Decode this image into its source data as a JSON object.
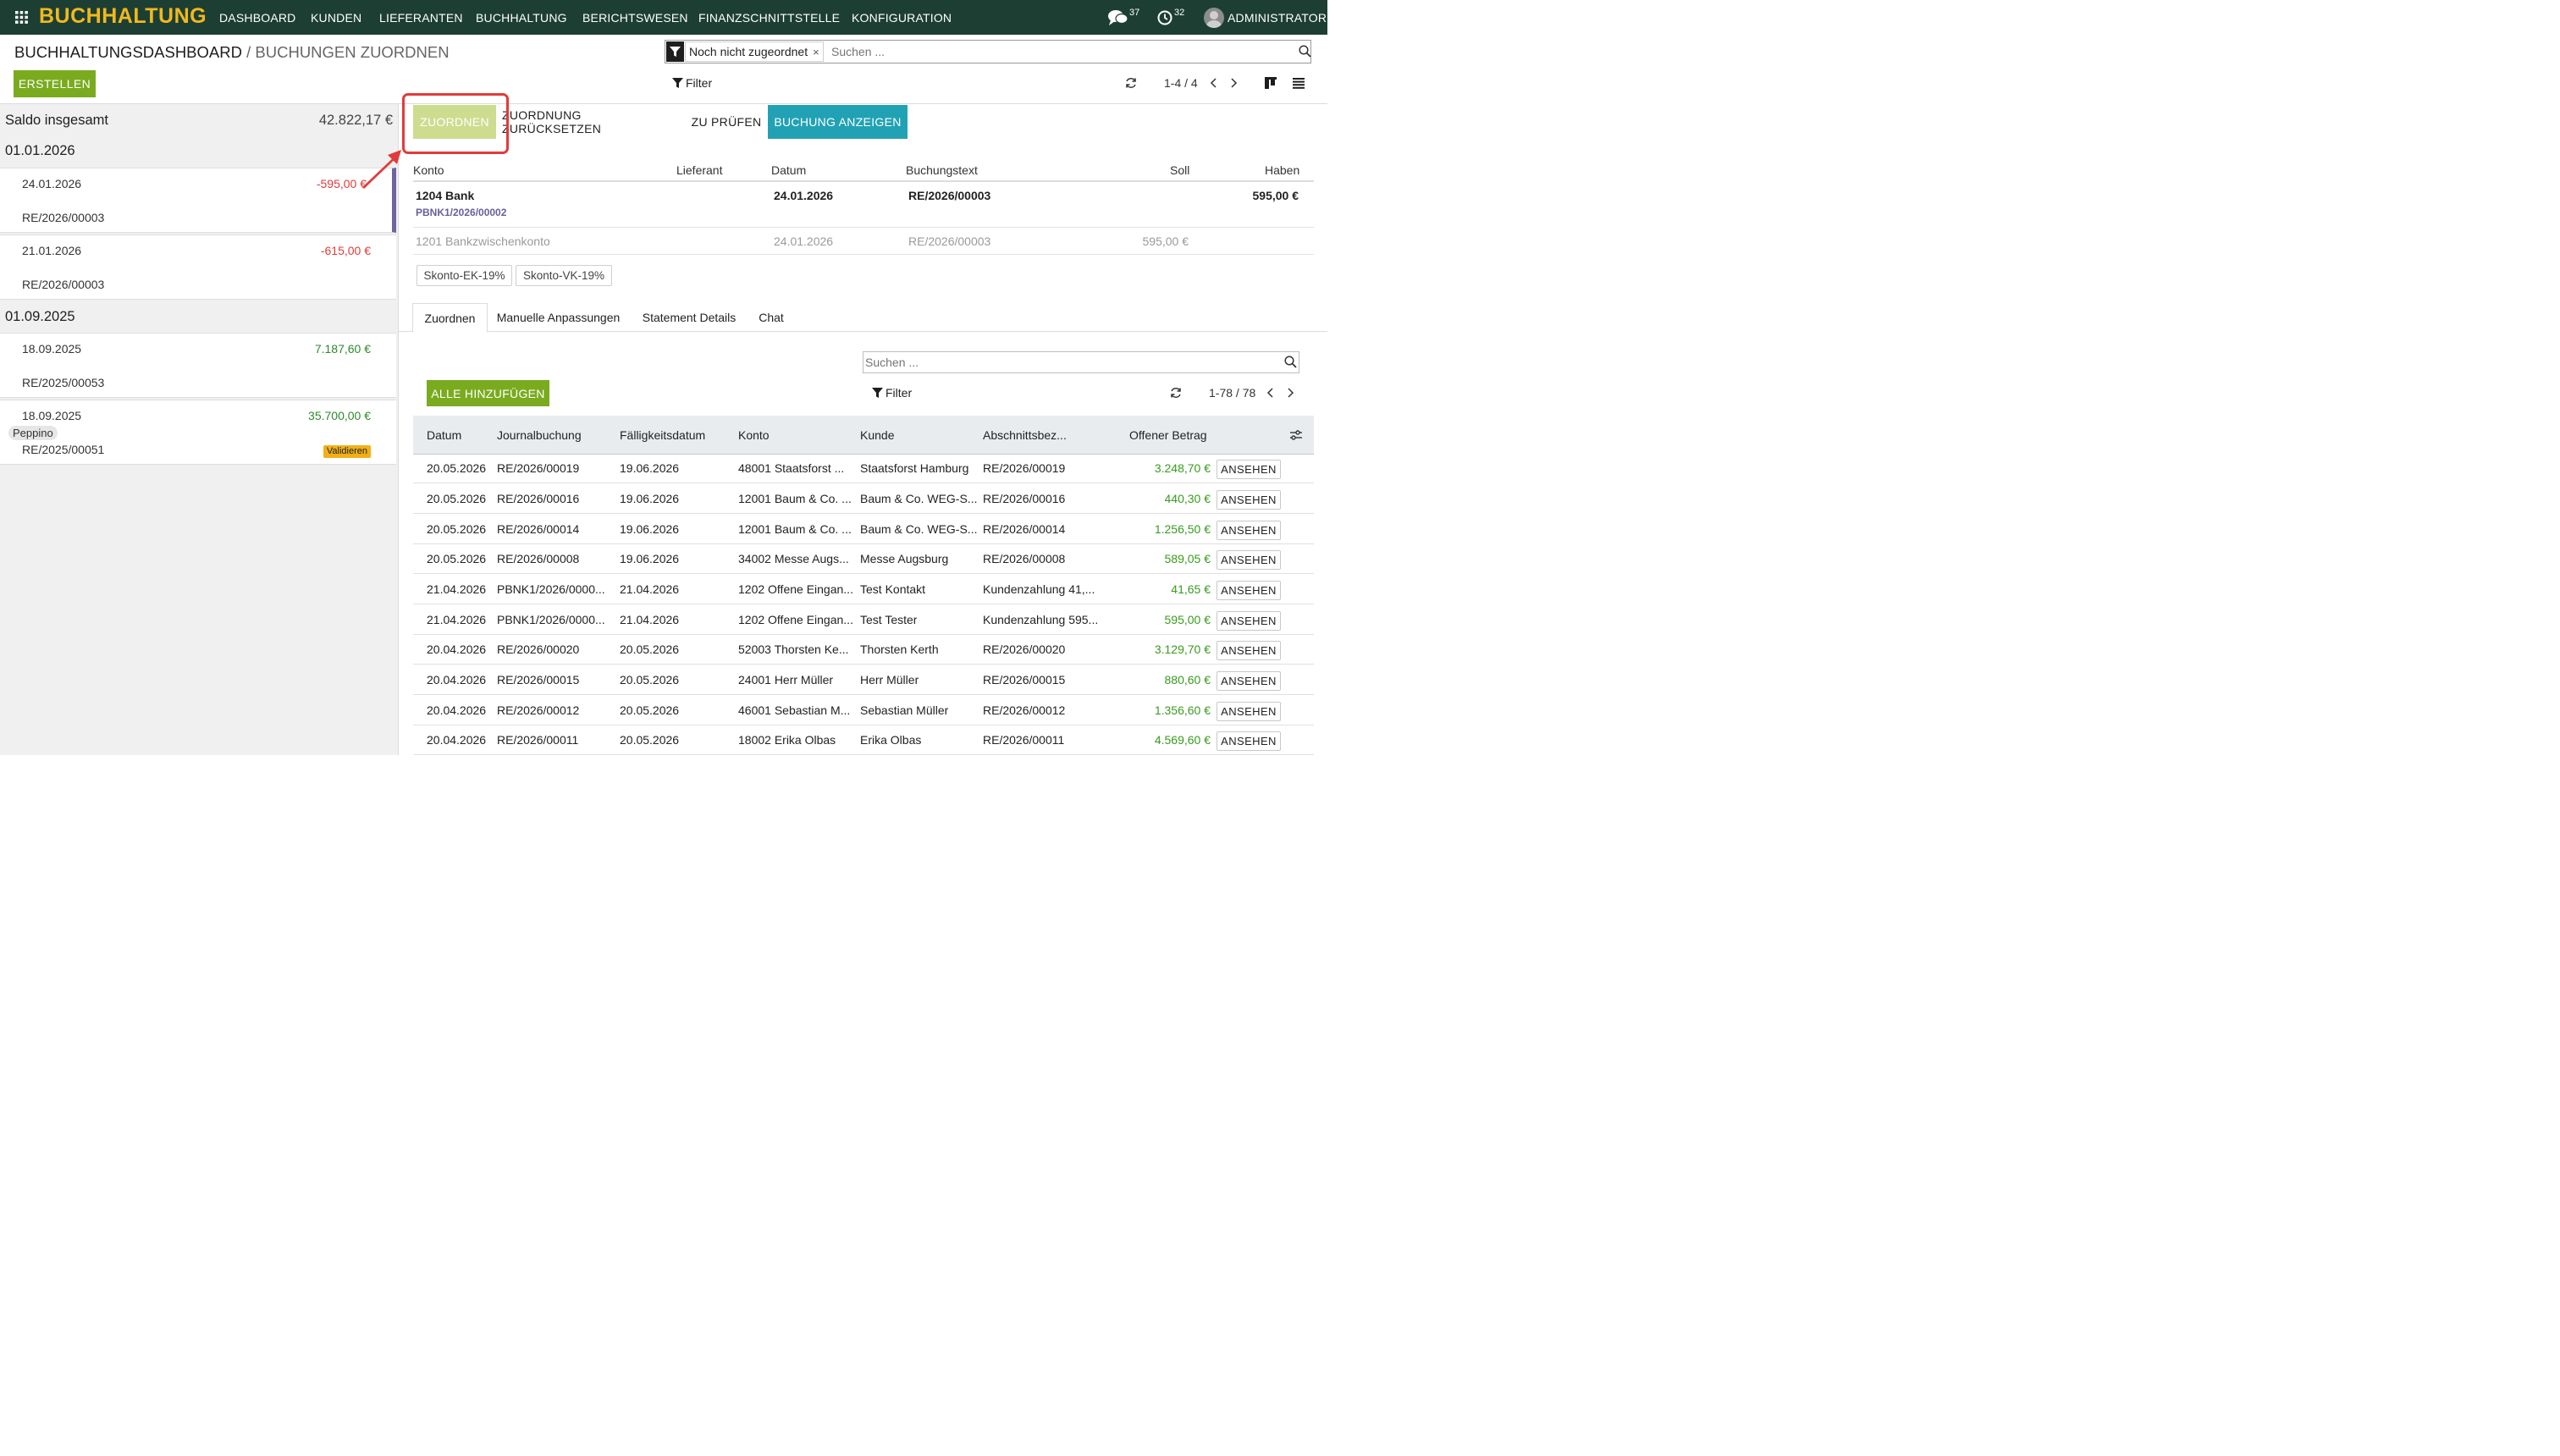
{
  "topbar": {
    "app_title": "BUCHHALTUNG",
    "menu": [
      "DASHBOARD",
      "KUNDEN",
      "LIEFERANTEN",
      "BUCHHALTUNG",
      "BERICHTSWESEN",
      "FINANZSCHNITTSTELLE",
      "KONFIGURATION"
    ],
    "messages_count": "37",
    "activities_count": "32",
    "user_name": "ADMINISTRATOR"
  },
  "breadcrumb": {
    "root": "BUCHHALTUNGSDASHBOARD",
    "separator": "/",
    "current": "BUCHUNGEN ZUORDNEN"
  },
  "search": {
    "facet": "Noch nicht zugeordnet",
    "placeholder": "Suchen ..."
  },
  "controls": {
    "create_label": "ERSTELLEN",
    "filter_label": "Filter",
    "pager": "1-4 / 4"
  },
  "left": {
    "balance_label": "Saldo insgesamt",
    "balance_value": "42.822,17 €",
    "groups": [
      {
        "date": "01.01.2026",
        "entries": [
          {
            "date": "24.01.2026",
            "amount": "-595,00 €",
            "ref": "RE/2026/00003",
            "partner": "",
            "badge": ""
          },
          {
            "date": "21.01.2026",
            "amount": "-615,00 €",
            "ref": "RE/2026/00003",
            "partner": "",
            "badge": ""
          }
        ]
      },
      {
        "date": "01.09.2025",
        "entries": [
          {
            "date": "18.09.2025",
            "amount": "7.187,60 €",
            "ref": "RE/2025/00053",
            "partner": "",
            "badge": ""
          },
          {
            "date": "18.09.2025",
            "amount": "35.700,00 €",
            "ref": "RE/2025/00051",
            "partner": "Peppino",
            "badge": "Validieren"
          }
        ]
      }
    ]
  },
  "actions": {
    "match": "ZUORDNEN",
    "reset": "ZUORDNUNG ZURÜCKSETZEN",
    "check": "ZU PRÜFEN",
    "show": "BUCHUNG ANZEIGEN"
  },
  "lines_header": {
    "konto": "Konto",
    "lieferant": "Lieferant",
    "datum": "Datum",
    "buchungstext": "Buchungstext",
    "soll": "Soll",
    "haben": "Haben"
  },
  "lines": [
    {
      "konto": "1204 Bank",
      "sub": "PBNK1/2026/00002",
      "datum": "24.01.2026",
      "text": "RE/2026/00003",
      "soll": "",
      "haben": "595,00 €"
    },
    {
      "konto": "1201 Bankzwischenkonto",
      "sub": "",
      "datum": "24.01.2026",
      "text": "RE/2026/00003",
      "soll": "595,00 €",
      "haben": ""
    }
  ],
  "tags": [
    "Skonto-EK-19%",
    "Skonto-VK-19%"
  ],
  "tabs": [
    "Zuordnen",
    "Manuelle Anpassungen",
    "Statement Details",
    "Chat"
  ],
  "match": {
    "search_placeholder": "Suchen ...",
    "add_all_label": "ALLE HINZUFÜGEN",
    "filter_label": "Filter",
    "pager": "1-78 / 78",
    "columns": [
      "Datum",
      "Journalbuchung",
      "Fälligkeitsdatum",
      "Konto",
      "Kunde",
      "Abschnittsbez...",
      "Offener Betrag"
    ],
    "view_label": "ANSEHEN",
    "rows": [
      [
        "20.05.2026",
        "RE/2026/00019",
        "19.06.2026",
        "48001 Staatsforst ...",
        "Staatsforst Hamburg",
        "RE/2026/00019",
        "3.248,70 €"
      ],
      [
        "20.05.2026",
        "RE/2026/00016",
        "19.06.2026",
        "12001 Baum & Co. ...",
        "Baum & Co. WEG-S...",
        "RE/2026/00016",
        "440,30 €"
      ],
      [
        "20.05.2026",
        "RE/2026/00014",
        "19.06.2026",
        "12001 Baum & Co. ...",
        "Baum & Co. WEG-S...",
        "RE/2026/00014",
        "1.256,50 €"
      ],
      [
        "20.05.2026",
        "RE/2026/00008",
        "19.06.2026",
        "34002 Messe Augs...",
        "Messe Augsburg",
        "RE/2026/00008",
        "589,05 €"
      ],
      [
        "21.04.2026",
        "PBNK1/2026/0000...",
        "21.04.2026",
        "1202 Offene Eingan...",
        "Test Kontakt",
        "Kundenzahlung 41,...",
        "41,65 €"
      ],
      [
        "21.04.2026",
        "PBNK1/2026/0000...",
        "21.04.2026",
        "1202 Offene Eingan...",
        "Test Tester",
        "Kundenzahlung 595...",
        "595,00 €"
      ],
      [
        "20.04.2026",
        "RE/2026/00020",
        "20.05.2026",
        "52003 Thorsten Ke...",
        "Thorsten Kerth",
        "RE/2026/00020",
        "3.129,70 €"
      ],
      [
        "20.04.2026",
        "RE/2026/00015",
        "20.05.2026",
        "24001 Herr Müller",
        "Herr Müller",
        "RE/2026/00015",
        "880,60 €"
      ],
      [
        "20.04.2026",
        "RE/2026/00012",
        "20.05.2026",
        "46001 Sebastian M...",
        "Sebastian Müller",
        "RE/2026/00012",
        "1.356,60 €"
      ],
      [
        "20.04.2026",
        "RE/2026/00011",
        "20.05.2026",
        "18002 Erika Olbas",
        "Erika Olbas",
        "RE/2026/00011",
        "4.569,60 €"
      ]
    ]
  },
  "colors": {
    "topbar_bg": "#1d3f33",
    "app_title": "#f1b81e",
    "primary_green": "#7aab1f",
    "match_btn_bg": "#cddc8f",
    "teal_btn": "#21a2b4",
    "negative": "#e03b3b",
    "positive": "#2e8a2e",
    "highlight": "#e23b3b",
    "account_sub": "#6b5e9a"
  }
}
